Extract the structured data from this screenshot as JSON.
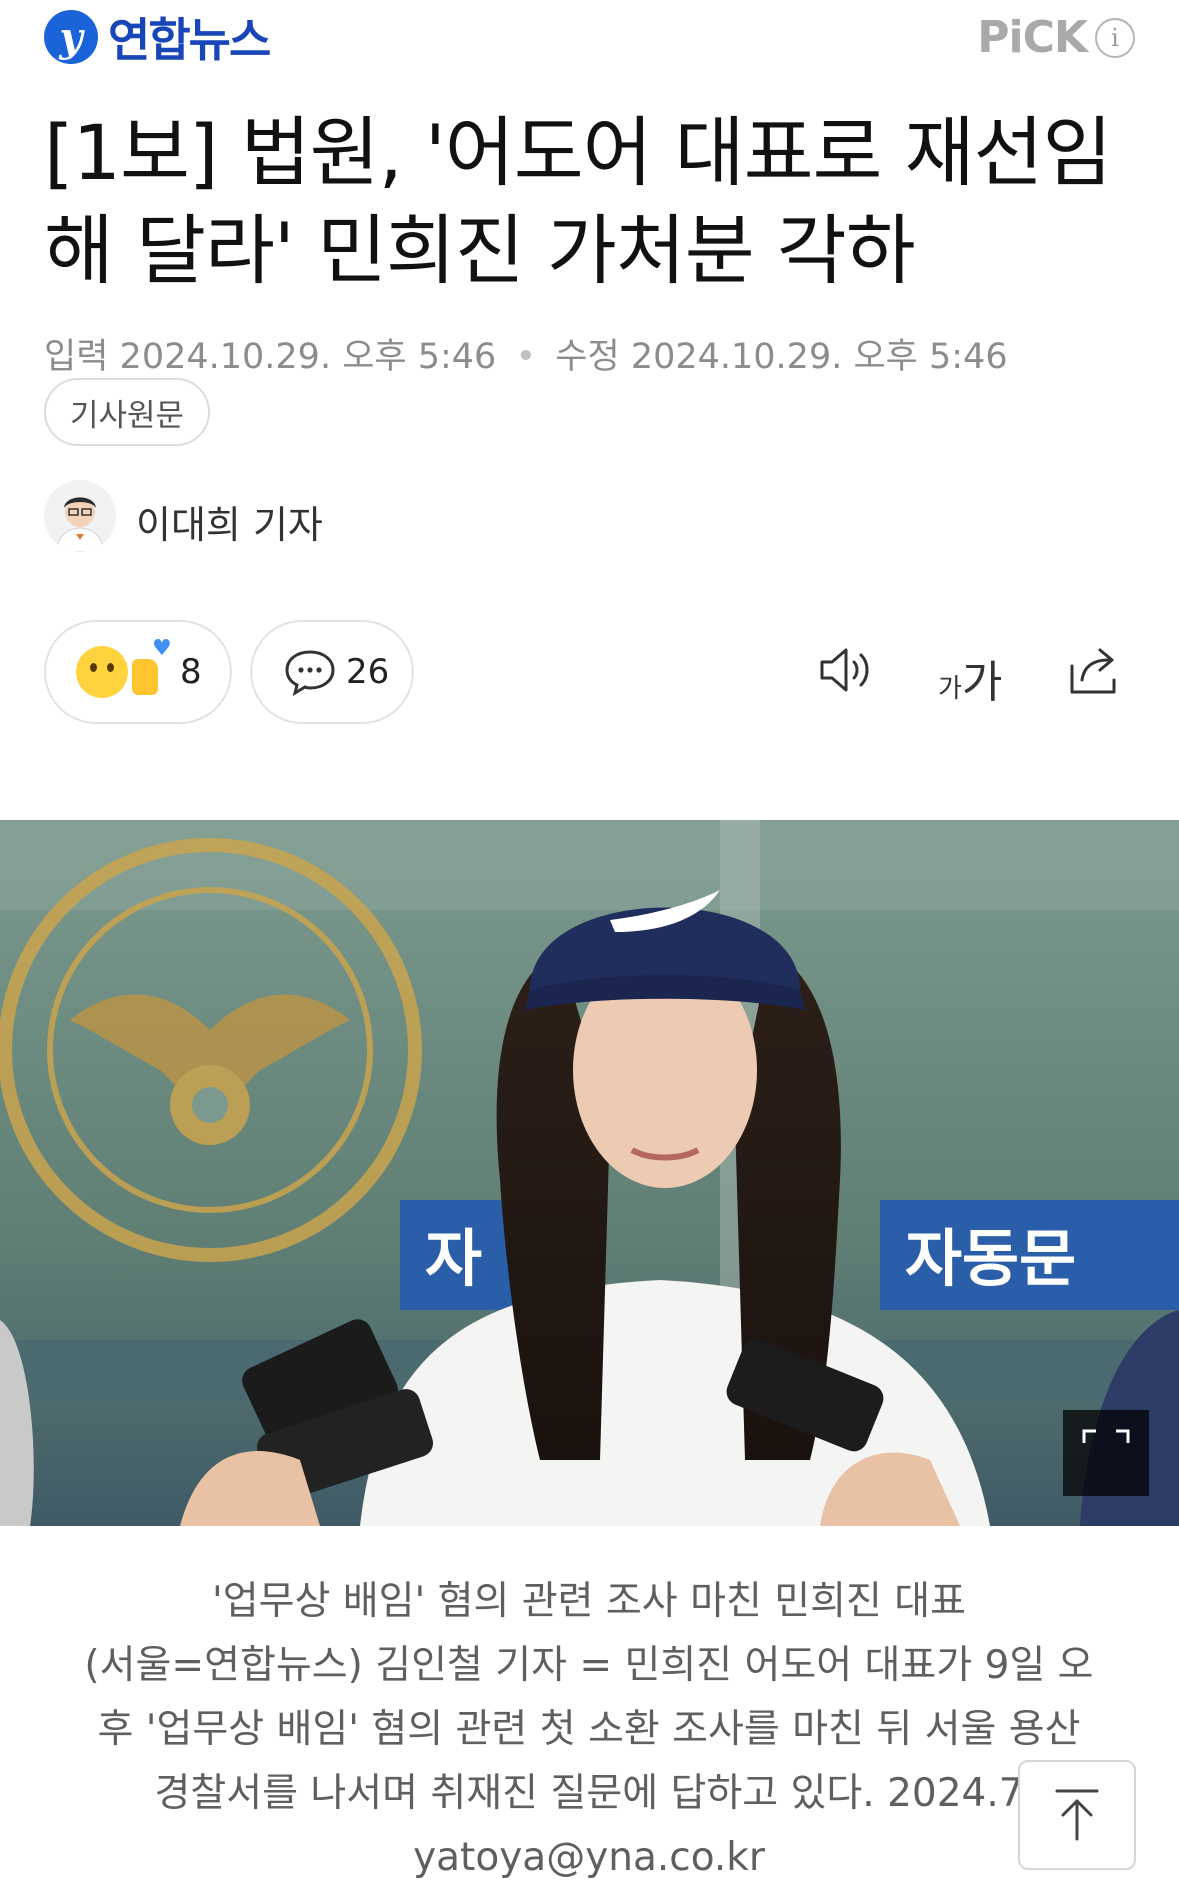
{
  "header": {
    "brand_name": "연합뉴스",
    "brand_mark": "y",
    "pick_label": "PiCK",
    "info_label": "i"
  },
  "article": {
    "title": "[1보] 법원, '어도어 대표로 재선임해 달라' 민희진 가처분 각하",
    "meta": {
      "input_label": "입력",
      "input_date": "2024.10.29. 오후 5:46",
      "separator": "•",
      "modified_label": "수정",
      "modified_date": "2024.10.29. 오후 5:46"
    },
    "original_button": "기사원문",
    "reporter": "이대희 기자"
  },
  "actions": {
    "reaction_count": "8",
    "comment_count": "26",
    "font_small": "가",
    "font_large": "가",
    "icons": [
      "emoji-reaction-icon",
      "comment-bubble-icon",
      "speaker-icon",
      "font-size-icon",
      "share-icon"
    ]
  },
  "photo": {
    "sign_left": "자",
    "sign_right": "자동문"
  },
  "caption": {
    "title": "'업무상 배임' 혐의 관련 조사 마친 민희진 대표",
    "body_line1": "(서울=연합뉴스) 김인철 기자 = 민희진 어도어 대표가 9일 오",
    "body_line2": "후 '업무상 배임' 혐의 관련 첫 소환 조사를 마친 뒤 서울 용산",
    "body_line3": "경찰서를 나서며 취재진 질문에 답하고 있다. 2024.7",
    "email": "yatoya@yna.co.kr"
  },
  "colors": {
    "brand_blue": "#1846b8",
    "meta_gray": "#8c8c8c",
    "caption_gray": "#5f5f5f"
  }
}
